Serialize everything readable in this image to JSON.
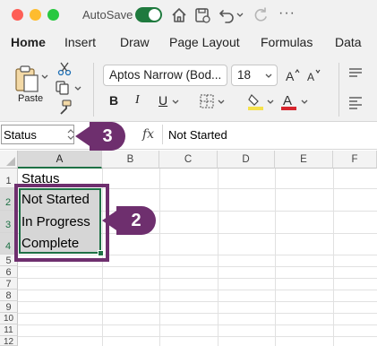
{
  "titlebar": {
    "autosave_label": "AutoSave",
    "icons": [
      "close-dot",
      "minimize-dot",
      "zoom-dot",
      "home-icon",
      "save-icon",
      "undo-icon",
      "redo-icon",
      "more-icon"
    ],
    "more": "···"
  },
  "ribbon_tabs": [
    "Home",
    "Insert",
    "Draw",
    "Page Layout",
    "Formulas",
    "Data"
  ],
  "ribbon": {
    "paste_label": "Paste",
    "font_name": "Aptos Narrow (Bod...",
    "font_size": "18",
    "bold": "B",
    "italic": "I",
    "underline": "U"
  },
  "formula_bar": {
    "name_box": "Status",
    "fx": "fx",
    "content": "Not Started"
  },
  "columns": [
    "A",
    "B",
    "C",
    "D",
    "E",
    "F"
  ],
  "rows": [
    "1",
    "2",
    "3",
    "4",
    "5",
    "6",
    "7",
    "8",
    "9",
    "10",
    "11",
    "12"
  ],
  "cells": {
    "A1": "Status",
    "A2": "Not Started",
    "A3": "In Progress",
    "A4": "Complete"
  },
  "callouts": {
    "name_box_step": "3",
    "selection_step": "2"
  },
  "colors": {
    "accent_green": "#1e7145",
    "callout_purple": "#6e2f6e",
    "highlight_yellow": "#f5e14b",
    "font_red": "#d7262e"
  }
}
